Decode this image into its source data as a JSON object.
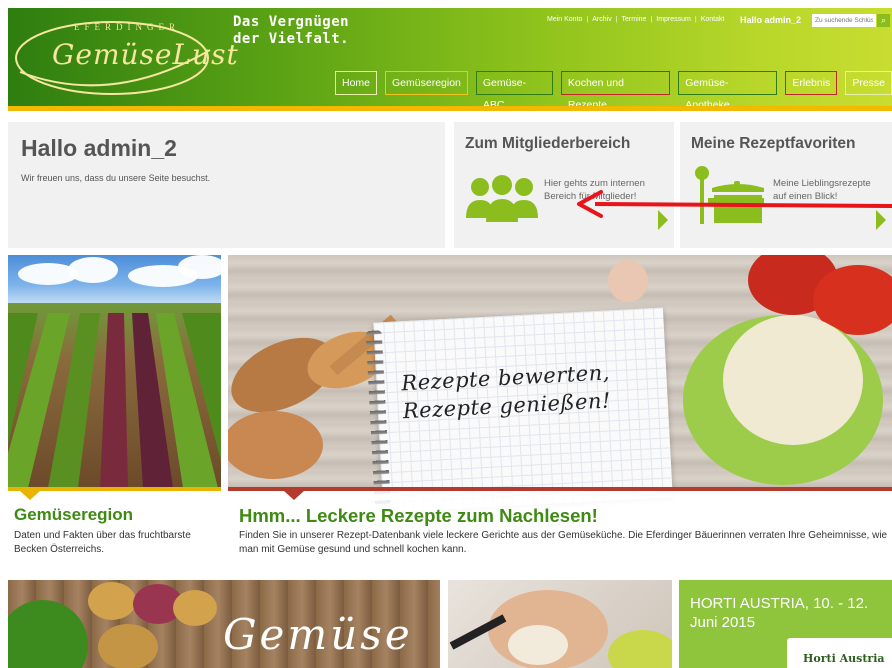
{
  "brand": {
    "eferding": "EFERDINGER",
    "name": "GemüseLust",
    "slogan_line1": "Das Vergnügen",
    "slogan_line2": "der Vielfalt."
  },
  "topnav": [
    "Mein Konto",
    "Archiv",
    "Termine",
    "Impressum",
    "Kontakt"
  ],
  "user_greeting": "Hallo admin_2",
  "search": {
    "placeholder": "Zu suchende Schlüssel"
  },
  "mainnav": [
    {
      "label": "Home"
    },
    {
      "label": "Gemüseregion"
    },
    {
      "label": "Gemüse-ABC"
    },
    {
      "label": "Kochen und Rezepte"
    },
    {
      "label": "Gemüse-Apotheke"
    },
    {
      "label": "Erlebnis"
    },
    {
      "label": "Presse"
    }
  ],
  "hello_box": {
    "title": "Hallo admin_2",
    "text": "Wir freuen uns, dass du unsere Seite besuchst."
  },
  "member_box": {
    "title": "Zum Mitgliederbereich",
    "desc_line1": "Hier gehts zum internen",
    "desc_line2": "Bereich für Mitglieder!"
  },
  "fav_box": {
    "title": "Meine Rezeptfavoriten",
    "desc_line1": "Meine Lieblingsrezepte",
    "desc_line2": "auf einen Blick!"
  },
  "tiles": {
    "region": {
      "title": "Gemüseregion",
      "text": "Daten und Fakten über das fruchtbarste Becken Österreichs."
    },
    "rezept": {
      "title": "Hmm... Leckere Rezepte zum Nachlesen!",
      "text": "Finden Sie in unserer Rezept-Datenbank viele leckere Gerichte aus der Gemüseküche. Die Eferdinger Bäuerinnen verraten Ihre Geheimnisse, wie man mit Gemüse gesund und schnell kochen kann.",
      "notebook_line1": "Rezepte bewerten,",
      "notebook_line2": "Rezepte genießen!"
    },
    "gemuese_word": "Gemüse",
    "horti_title": "HORTI AUSTRIA, 10. - 12. Juni 2015",
    "horti_logo": "Horti Austria"
  },
  "colors": {
    "accent_green": "#8cbd1e",
    "title_green": "#3f8a13",
    "annotation_red": "#e8141b"
  }
}
